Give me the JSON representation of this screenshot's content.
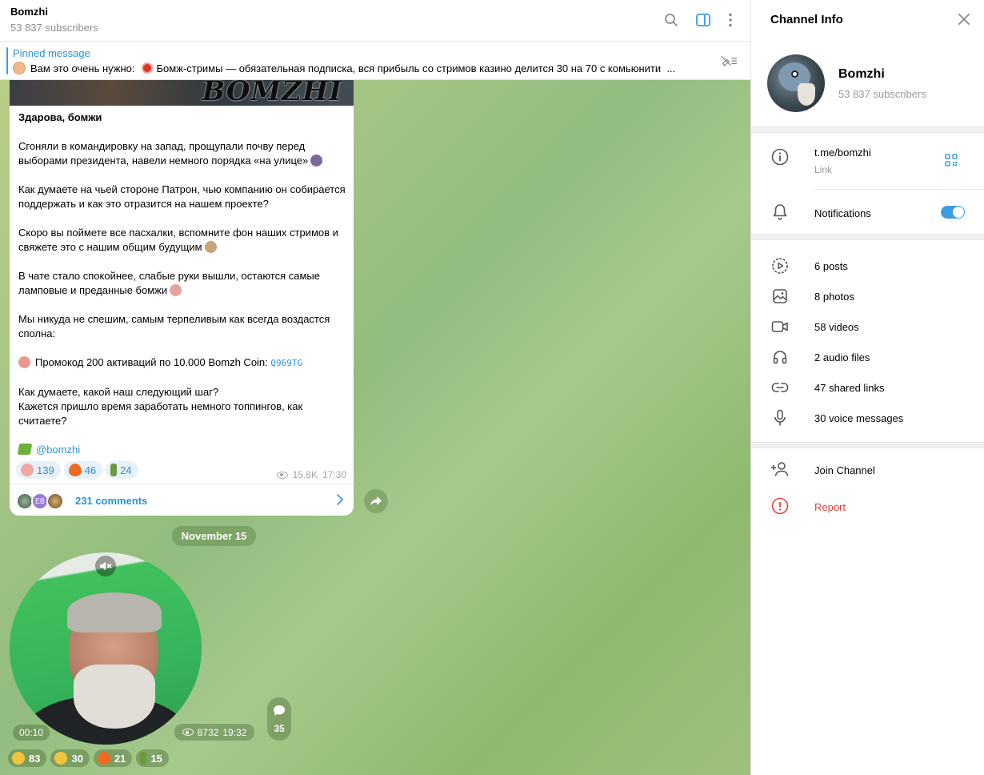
{
  "chat": {
    "title": "Bomzhi",
    "subtitle": "53 837 subscribers"
  },
  "pinned": {
    "label": "Pinned message",
    "text_prefix": "Вам это очень нужно:",
    "text": "Бомж-стримы — обязательная подписка, вся прибыль со стримов казино делится 30 на 70 с комьюнити",
    "ellipsis": "..."
  },
  "post": {
    "image_text": "BOMZHI",
    "greeting": "Здарова, бомжи",
    "p1": "Сгоняли в командировку на запад, прощупали почву перед выборами президента, навели немного порядка «на улице»",
    "p2": "Как думаете на чьей стороне Патрон, чью компанию он собирается поддержать и как это отразится на нашем проекте?",
    "p3": "Скоро вы поймете все пасхалки, вспомните фон наших стримов и  свяжете это  с нашим общим будущим",
    "p4": "В чате стало спокойнее, слабые руки вышли, остаются самые ламповые и преданные бомжи",
    "p5": "Мы никуда не спешим, самым терпеливым как всегда воздастся сполна:",
    "promo_text": "Промокод 200 активаций по 10.000 Bomzh Coin:",
    "promo_code": "Q969TG",
    "p6a": "Как думаете, какой наш следующий шаг?",
    "p6b": "Кажется пришло время заработать немного топпингов, как считаете?",
    "signature": "@bomzhi",
    "reactions": [
      {
        "emoji": "pig-face",
        "count": "139",
        "color": "#f2a7a0"
      },
      {
        "emoji": "fire",
        "count": "46",
        "color": "#f06a1f"
      },
      {
        "emoji": "champagne",
        "count": "24",
        "color": "#6a9a3c"
      }
    ],
    "views": "15.8K",
    "time": "17:30",
    "comments_avatar_initials": "EB",
    "comments_label": "231 comments"
  },
  "date_separator": "November 15",
  "video": {
    "duration": "00:10",
    "views": "8732",
    "time": "19:32",
    "comment_count": "35",
    "reactions": [
      {
        "emoji": "crying",
        "count": "83",
        "color": "#f5c33b"
      },
      {
        "emoji": "scream",
        "count": "30",
        "color": "#f5c33b"
      },
      {
        "emoji": "fire",
        "count": "21",
        "color": "#f06a1f"
      },
      {
        "emoji": "champagne",
        "count": "15",
        "color": "#6a9a3c"
      }
    ]
  },
  "panel": {
    "title": "Channel Info",
    "channel_name": "Bomzhi",
    "channel_subs": "53 837 subscribers",
    "link": "t.me/bomzhi",
    "link_label": "Link",
    "notifications": "Notifications",
    "notifications_on": true,
    "media": [
      {
        "icon": "posts-icon",
        "label": "6 posts"
      },
      {
        "icon": "photo-icon",
        "label": "8 photos"
      },
      {
        "icon": "video-icon",
        "label": "58 videos"
      },
      {
        "icon": "headphones-icon",
        "label": "2 audio files"
      },
      {
        "icon": "link-icon",
        "label": "47 shared links"
      },
      {
        "icon": "microphone-icon",
        "label": "30 voice messages"
      }
    ],
    "join": "Join Channel",
    "report": "Report"
  },
  "colors": {
    "accent": "#3d9ce0",
    "link": "#2a94d6",
    "report": "#e0443c",
    "wallpaper": "#a6c585"
  }
}
